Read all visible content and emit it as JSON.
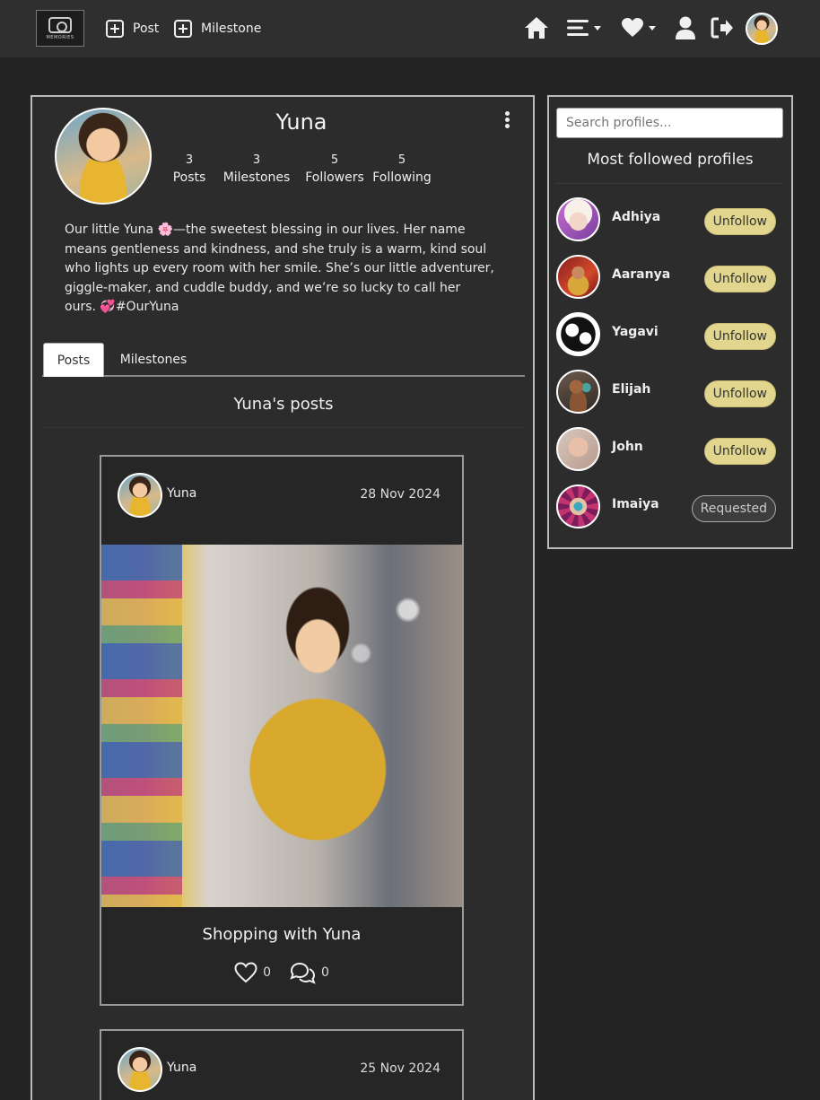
{
  "nav": {
    "logo_text": "MEMORIES",
    "post_label": "Post",
    "milestone_label": "Milestone"
  },
  "profile": {
    "name": "Yuna",
    "stats": [
      {
        "num": "3",
        "label": "Posts"
      },
      {
        "num": "3",
        "label": "Milestones"
      },
      {
        "num": "5",
        "label": "Followers"
      },
      {
        "num": "5",
        "label": "Following"
      }
    ],
    "bio": "Our little Yuna 🌸—the sweetest blessing in our lives. Her name means gentleness and kindness, and she truly is a warm, kind soul who lights up every room with her smile. She’s our little adventurer, giggle-maker, and cuddle buddy, and we’re so lucky to call her ours. 💞#OurYuna"
  },
  "tabs": {
    "posts": "Posts",
    "milestones": "Milestones"
  },
  "posts_heading": "Yuna's posts",
  "posts": [
    {
      "author": "Yuna",
      "date": "28 Nov 2024",
      "title": "Shopping with Yuna",
      "likes": "0",
      "comments": "0"
    },
    {
      "author": "Yuna",
      "date": "25 Nov 2024"
    }
  ],
  "sidebar": {
    "search_placeholder": "Search profiles...",
    "title": "Most followed profiles",
    "people": [
      {
        "name": "Adhiya",
        "action": "Unfollow"
      },
      {
        "name": "Aaranya",
        "action": "Unfollow"
      },
      {
        "name": "Yagavi",
        "action": "Unfollow"
      },
      {
        "name": "Elijah",
        "action": "Unfollow"
      },
      {
        "name": "John",
        "action": "Unfollow"
      },
      {
        "name": "Imaiya",
        "action": "Requested"
      }
    ]
  },
  "colors": {
    "background": "#242424",
    "navbar": "#2f2f2f",
    "unfollow_button": "#e2d68e"
  }
}
